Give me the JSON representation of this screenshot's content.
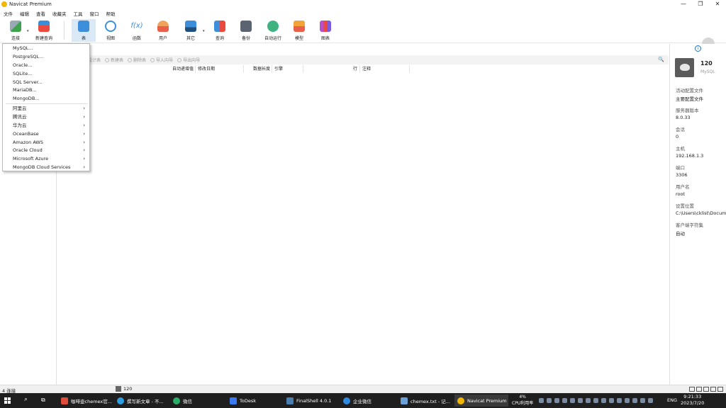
{
  "window": {
    "title": "Navicat Premium",
    "controls": [
      "—",
      "❐",
      "✕"
    ]
  },
  "menu": [
    "文件",
    "编辑",
    "查看",
    "收藏夹",
    "工具",
    "窗口",
    "帮助"
  ],
  "toolbar": {
    "connect": "连接",
    "new_query": "新建查询",
    "table": "表",
    "view": "视图",
    "function": "函数",
    "user": "用户",
    "other": "其它",
    "query": "查询",
    "backup": "备份",
    "automation": "自动运行",
    "model": "模型",
    "chart": "图表",
    "function_icon_text": "f(x)"
  },
  "object_toolbar": {
    "design": "设计表",
    "new": "新建表",
    "delete": "删除表",
    "import": "导入向导",
    "export": "导出向导",
    "search_icon": "🔍"
  },
  "columns": [
    "自动递增值",
    "修改日期",
    "数据长度",
    "引擎",
    "行",
    "注释"
  ],
  "dropdown": {
    "items": [
      "MySQL...",
      "PostgreSQL...",
      "Oracle...",
      "SQLite...",
      "SQL Server...",
      "MariaDB...",
      "MongoDB..."
    ],
    "cloud": [
      "阿里云",
      "腾讯云",
      "华为云",
      "OceanBase",
      "Amazon AWS",
      "Oracle Cloud",
      "Microsoft Azure",
      "MongoDB Cloud Services"
    ],
    "arrow": "›"
  },
  "info": {
    "icon": "i",
    "name": "120",
    "type": "MySQL",
    "props": [
      {
        "k": "活动配置文件",
        "v": "主要配置文件"
      },
      {
        "k": "服务器版本",
        "v": "8.0.33"
      },
      {
        "k": "会话",
        "v": "0"
      },
      {
        "k": "主机",
        "v": "192.168.1.3"
      },
      {
        "k": "端口",
        "v": "3306"
      },
      {
        "k": "用户名",
        "v": "root"
      },
      {
        "k": "设置位置",
        "v": "C:\\Users\\cklist\\Docum"
      },
      {
        "k": "客户端字符集",
        "v": "自动"
      }
    ]
  },
  "status": {
    "count": "4 连接",
    "selected": "120"
  },
  "taskbar": {
    "apps": [
      {
        "label": "咖啡壶chemex官...",
        "color": "#e04b3a"
      },
      {
        "label": "撰写新文章 - 不...",
        "color": "#2f9ee0"
      },
      {
        "label": "微信",
        "color": "#2aae67"
      },
      {
        "label": "ToDesk",
        "color": "#3a7cf0"
      },
      {
        "label": "FinalShell 4.0.1",
        "color": "#4a7fb0"
      },
      {
        "label": "企业微信",
        "color": "#2f8ae0"
      },
      {
        "label": "chemex.txt - 记...",
        "color": "#6aa0d8"
      },
      {
        "label": "Navicat Premium",
        "color": "#f2b705"
      }
    ],
    "cpu_value": "4%",
    "cpu_label": "CPU利用率",
    "lang": "ENG",
    "time": "9:21:33",
    "date": "2023/7/20"
  },
  "colors": {
    "accent": "#1e73c8",
    "selected_tool": "#dbe8f6",
    "taskbar": "#1f1f1f"
  }
}
